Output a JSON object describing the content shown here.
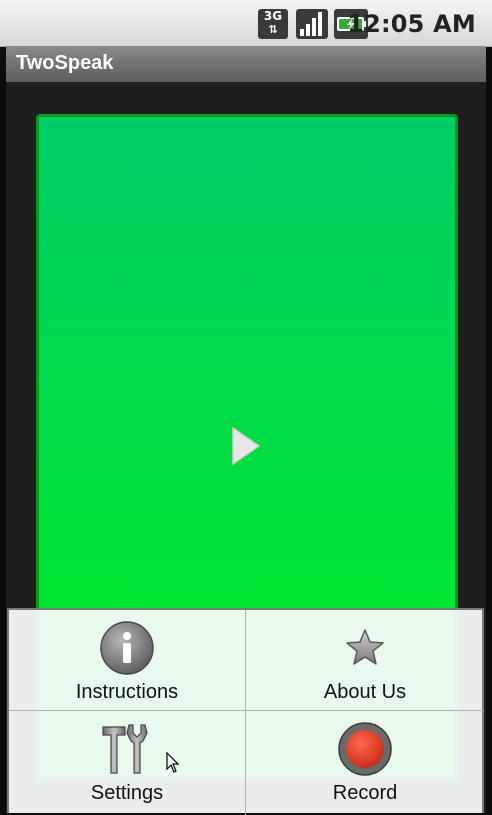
{
  "status_bar": {
    "network": "3G",
    "time": "12:05 AM",
    "icons": [
      "3g-icon",
      "signal-icon",
      "battery-icon"
    ]
  },
  "app": {
    "title": "TwoSpeak"
  },
  "player": {
    "icon": "play-icon",
    "gradient_top": "#00cc66",
    "gradient_bottom": "#00ee22"
  },
  "menu": {
    "items": [
      {
        "label": "Instructions",
        "icon": "info-icon"
      },
      {
        "label": "About Us",
        "icon": "star-icon"
      },
      {
        "label": "Settings",
        "icon": "tools-icon"
      },
      {
        "label": "Record",
        "icon": "record-icon"
      }
    ]
  }
}
